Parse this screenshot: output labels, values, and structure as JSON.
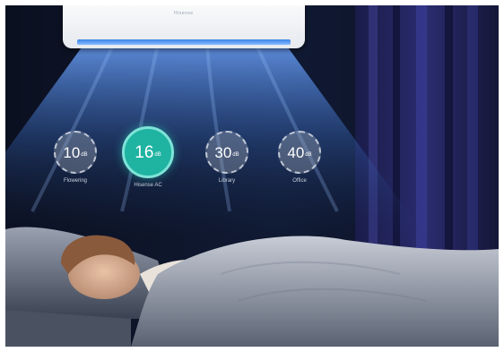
{
  "ac": {
    "brand": "Hisense"
  },
  "badges": [
    {
      "value": "10",
      "unit": "dB",
      "label": "Flowering"
    },
    {
      "value": "16",
      "unit": "dB",
      "label": "Hisense AC"
    },
    {
      "value": "30",
      "unit": "dB",
      "label": "Library"
    },
    {
      "value": "40",
      "unit": "dB",
      "label": "Office"
    }
  ],
  "colors": {
    "highlight": "#1fb3a2",
    "night": "#0a0e1a",
    "airflow": "#4a8fe8"
  }
}
